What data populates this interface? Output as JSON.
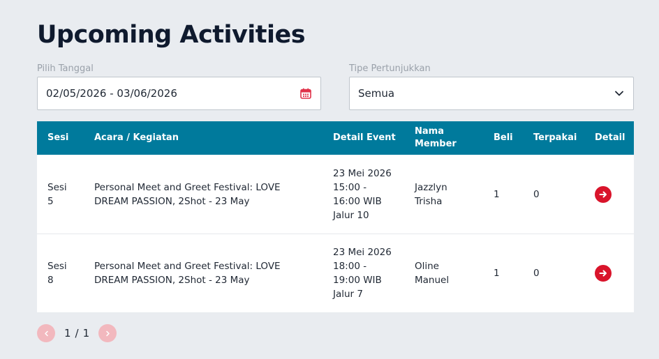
{
  "page": {
    "title": "Upcoming Activities"
  },
  "filters": {
    "date": {
      "label": "Pilih Tanggal",
      "value": "02/05/2026 - 03/06/2026",
      "icon": "calendar-icon"
    },
    "type": {
      "label": "Tipe Pertunjukkan",
      "value": "Semua",
      "icon": "chevron-down-icon"
    }
  },
  "table": {
    "headers": {
      "sesi": "Sesi",
      "acara": "Acara / Kegiatan",
      "detail_event": "Detail Event",
      "nama_member": "Nama\nMember",
      "beli": "Beli",
      "terpakai": "Terpakai",
      "detail": "Detail"
    },
    "rows": [
      {
        "sesi": "Sesi\n5",
        "acara": "Personal Meet and Greet Festival: LOVE DREAM PASSION, 2Shot - 23 May",
        "detail_event": "23 Mei 2026\n15:00 -\n16:00 WIB\nJalur 10",
        "nama_member": "Jazzlyn\nTrisha",
        "beli": "1",
        "terpakai": "0"
      },
      {
        "sesi": "Sesi\n8",
        "acara": "Personal Meet and Greet Festival: LOVE DREAM PASSION, 2Shot - 23 May",
        "detail_event": "23 Mei 2026\n18:00 -\n19:00 WIB\nJalur 7",
        "nama_member": "Oline\nManuel",
        "beli": "1",
        "terpakai": "0"
      }
    ]
  },
  "pagination": {
    "current": "1",
    "separator": "/",
    "total": "1"
  },
  "colors": {
    "background": "#e9ecf0",
    "header": "#007a9c",
    "accent": "#d9142b",
    "pagination_disabled": "#f2b8be"
  }
}
